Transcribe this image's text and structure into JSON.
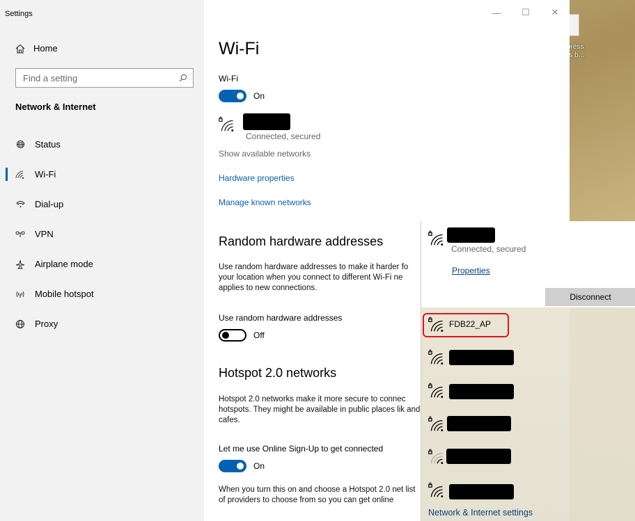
{
  "window": {
    "app_title": "Settings",
    "controls": {
      "minimize": "—",
      "maximize": "☐",
      "close": "✕"
    }
  },
  "sidebar": {
    "home_label": "Home",
    "search_placeholder": "Find a setting",
    "section_title": "Network & Internet",
    "items": [
      {
        "label": "Status",
        "icon": "status-icon",
        "active": false
      },
      {
        "label": "Wi-Fi",
        "icon": "wifi-icon",
        "active": true
      },
      {
        "label": "Dial-up",
        "icon": "dialup-icon",
        "active": false
      },
      {
        "label": "VPN",
        "icon": "vpn-icon",
        "active": false
      },
      {
        "label": "Airplane mode",
        "icon": "airplane-icon",
        "active": false
      },
      {
        "label": "Mobile hotspot",
        "icon": "hotspot-icon",
        "active": false
      },
      {
        "label": "Proxy",
        "icon": "proxy-icon",
        "active": false
      }
    ]
  },
  "main": {
    "title": "Wi-Fi",
    "wifi_label": "Wi-Fi",
    "wifi_toggle": "On",
    "connected_status": "Connected, secured",
    "show_networks": "Show available networks",
    "hardware_properties": "Hardware properties",
    "manage_known": "Manage known networks",
    "random_title": "Random hardware addresses",
    "random_desc": "Use random hardware addresses to make it harder fo your location when you connect to different Wi-Fi ne applies to new connections.",
    "random_label": "Use random hardware addresses",
    "random_toggle": "Off",
    "hotspot_title": "Hotspot 2.0 networks",
    "hotspot_desc": "Hotspot 2.0 networks make it more secure to connec hotspots. They might be available in public places lik and cafes.",
    "signup_label": "Let me use Online Sign-Up to get connected",
    "signup_toggle": "On",
    "signup_desc": "When you turn this on and choose a Hotspot 2.0 net list of providers to choose from so you can get online"
  },
  "flyout": {
    "connected_status": "Connected, secured",
    "properties": "Properties",
    "disconnect": "Disconnect",
    "highlighted_network": "FDB22_AP",
    "footer": "Network & Internet settings"
  },
  "desktop": {
    "icon_label_1": "press",
    "icon_label_2": "rs b..."
  }
}
